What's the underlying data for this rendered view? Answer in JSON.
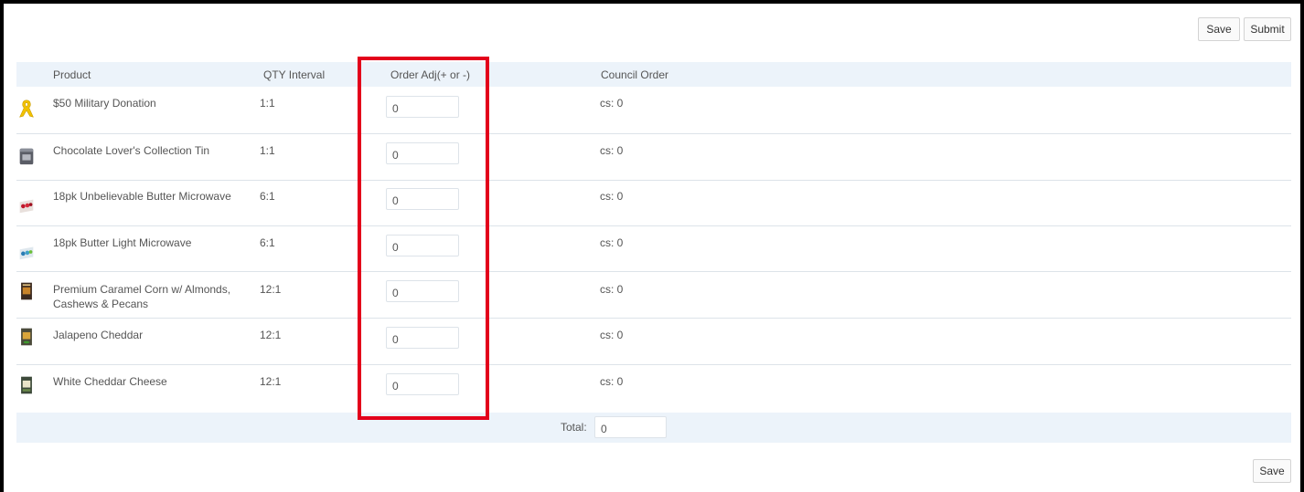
{
  "toolbar": {
    "save_label": "Save",
    "submit_label": "Submit"
  },
  "table": {
    "columns": [
      "Product",
      "QTY Interval",
      "Order Adj(+ or -)",
      "Council Order"
    ],
    "rows": [
      {
        "product": "$50 Military Donation",
        "qty_interval": "1:1",
        "order_adj": "0",
        "council_order": "cs: 0",
        "icon": "yellow-ribbon-icon"
      },
      {
        "product": "Chocolate Lover's Collection Tin",
        "qty_interval": "1:1",
        "order_adj": "0",
        "council_order": "cs: 0",
        "icon": "collection-tin-icon"
      },
      {
        "product": "18pk Unbelievable Butter Microwave",
        "qty_interval": "6:1",
        "order_adj": "0",
        "council_order": "cs: 0",
        "icon": "microwave-popcorn-box-icon"
      },
      {
        "product": "18pk Butter Light Microwave",
        "qty_interval": "6:1",
        "order_adj": "0",
        "council_order": "cs: 0",
        "icon": "butter-light-box-icon"
      },
      {
        "product": "Premium Caramel Corn w/ Almonds, Cashews & Pecans",
        "product_line1": "Premium Caramel Corn w/ Almonds,",
        "product_line2": "Cashews & Pecans",
        "qty_interval": "12:1",
        "order_adj": "0",
        "council_order": "cs: 0",
        "icon": "caramel-corn-bag-icon"
      },
      {
        "product": "Jalapeno Cheddar",
        "qty_interval": "12:1",
        "order_adj": "0",
        "council_order": "cs: 0",
        "icon": "jalapeno-cheddar-bag-icon"
      },
      {
        "product": "White Cheddar Cheese",
        "qty_interval": "12:1",
        "order_adj": "0",
        "council_order": "cs: 0",
        "icon": "white-cheddar-bag-icon"
      }
    ]
  },
  "total": {
    "label": "Total:",
    "value": "0"
  },
  "footer": {
    "save_label": "Save"
  },
  "colors": {
    "highlight": "#e3001b",
    "header_bg": "#ecf3fa"
  }
}
